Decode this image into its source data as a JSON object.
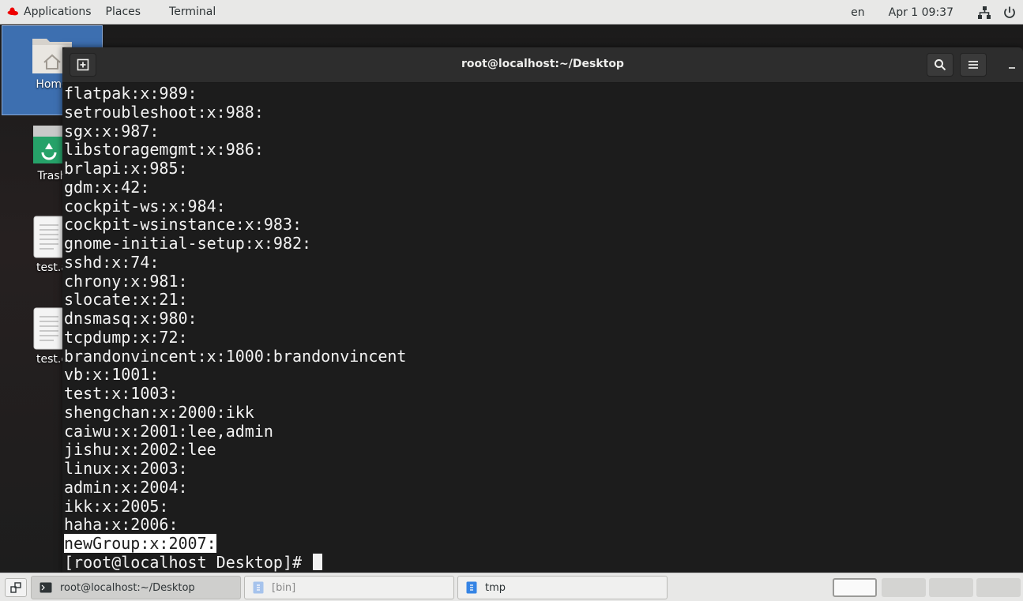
{
  "topbar": {
    "applications": "Applications",
    "places": "Places",
    "terminal": "Terminal",
    "language": "en",
    "clock": "Apr 1  09:37"
  },
  "desktop": {
    "icons": [
      {
        "label": "Home"
      },
      {
        "label": "Trash"
      },
      {
        "label": "test.a"
      },
      {
        "label": "test.e"
      }
    ]
  },
  "terminal": {
    "title": "root@localhost:~/Desktop",
    "lines": [
      "flatpak:x:989:",
      "setroubleshoot:x:988:",
      "sgx:x:987:",
      "libstoragemgmt:x:986:",
      "brlapi:x:985:",
      "gdm:x:42:",
      "cockpit-ws:x:984:",
      "cockpit-wsinstance:x:983:",
      "gnome-initial-setup:x:982:",
      "sshd:x:74:",
      "chrony:x:981:",
      "slocate:x:21:",
      "dnsmasq:x:980:",
      "tcpdump:x:72:",
      "brandonvincent:x:1000:brandonvincent",
      "vb:x:1001:",
      "test:x:1003:",
      "shengchan:x:2000:ikk",
      "caiwu:x:2001:lee,admin",
      "jishu:x:2002:lee",
      "linux:x:2003:",
      "admin:x:2004:",
      "ikk:x:2005:",
      "haha:x:2006:",
      "newGroup:x:2007:"
    ],
    "prompt": "[root@localhost Desktop]# "
  },
  "taskbar": {
    "tasks": [
      {
        "label": "root@localhost:~/Desktop"
      },
      {
        "label": "[bin]"
      },
      {
        "label": "tmp"
      }
    ]
  },
  "colors": {
    "terminal_bg": "#1c1c1c",
    "terminal_fg": "#f2f2f2",
    "topbar_bg": "#e8e8e7",
    "selection_bg": "#ffffff",
    "home_selected": "#3d6fb0"
  }
}
